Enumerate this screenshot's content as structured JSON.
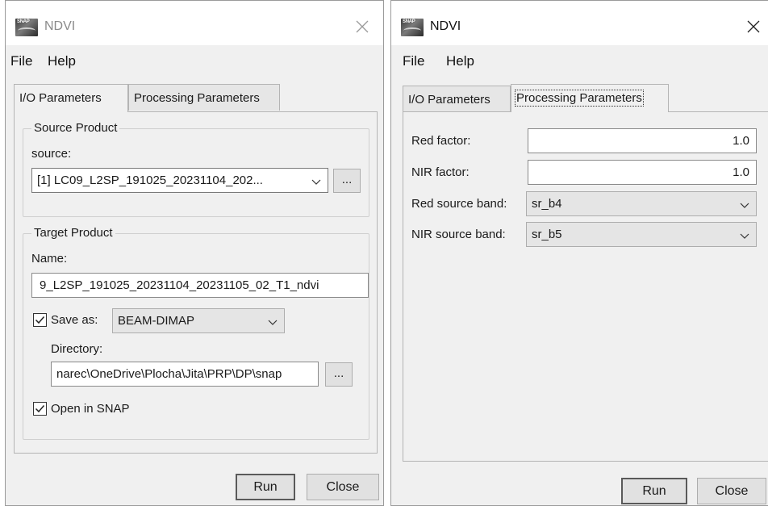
{
  "windows": [
    {
      "title": "NDVI",
      "icon": "snap-app-icon",
      "menu": [
        "File",
        "Help"
      ],
      "tabs": [
        "I/O Parameters",
        "Processing Parameters"
      ],
      "active_tab": 0,
      "source_product": {
        "group_title": "Source Product",
        "label": "source:",
        "value": "[1] LC09_L2SP_191025_20231104_202...",
        "browse_label": "..."
      },
      "target_product": {
        "group_title": "Target Product",
        "name_label": "Name:",
        "name_value": " 9_L2SP_191025_20231104_20231105_02_T1_ndvi",
        "save_as_label": "Save as:",
        "save_as_checked": true,
        "format_value": "BEAM-DIMAP",
        "directory_label": "Directory:",
        "directory_value": "narec\\OneDrive\\Plocha\\Jita\\PRP\\DP\\snap",
        "browse_label": "...",
        "open_in_snap_label": "Open in SNAP",
        "open_in_snap_checked": true
      },
      "buttons": {
        "run": "Run",
        "close": "Close"
      }
    },
    {
      "title": "NDVI",
      "icon": "snap-app-icon",
      "menu": [
        "File",
        "Help"
      ],
      "tabs": [
        "I/O Parameters",
        "Processing Parameters"
      ],
      "active_tab": 1,
      "params": {
        "red_factor_label": "Red factor:",
        "red_factor_value": "1.0",
        "nir_factor_label": "NIR factor:",
        "nir_factor_value": "1.0",
        "red_band_label": "Red source band:",
        "red_band_value": "sr_b4",
        "nir_band_label": "NIR source band:",
        "nir_band_value": "sr_b5"
      },
      "buttons": {
        "run": "Run",
        "close": "Close"
      }
    }
  ]
}
